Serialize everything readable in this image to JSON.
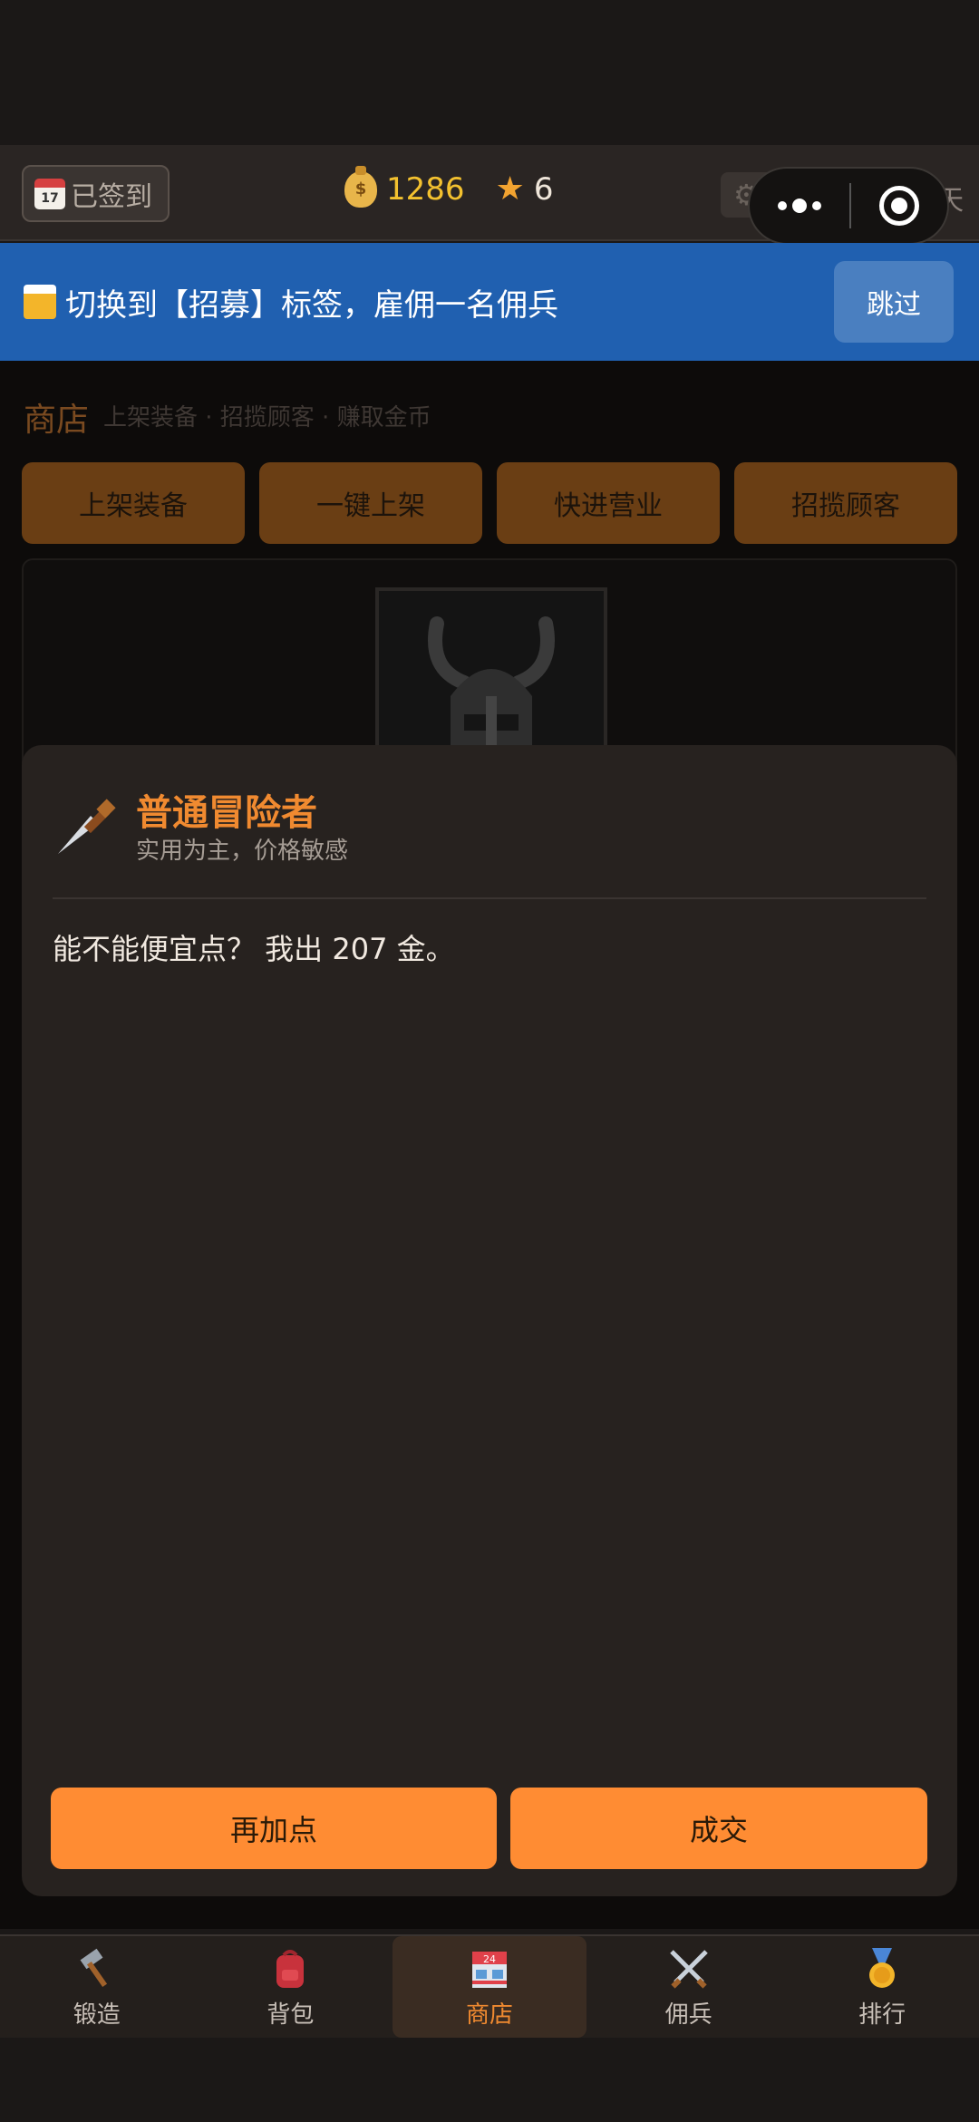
{
  "topbar": {
    "checkin_label": "已签到",
    "calendar_day": "17",
    "gold": "1286",
    "stars": "6",
    "settings_label": "设置",
    "day_label": "第 1 天"
  },
  "guide": {
    "text": "切换到【招募】标签，雇佣一名佣兵",
    "skip_label": "跳过"
  },
  "shop": {
    "title": "商店",
    "subtitle": "上架装备 · 招揽顾客 · 赚取金币",
    "actions": [
      "上架装备",
      "一键上架",
      "快进营业",
      "招揽顾客"
    ]
  },
  "dialog": {
    "name": "普通冒险者",
    "desc": "实用为主，价格敏感",
    "message": "能不能便宜点？ 我出 207 金。",
    "bargain_label": "再加点",
    "deal_label": "成交"
  },
  "nav": {
    "items": [
      {
        "label": "锻造",
        "icon": "hammer-icon"
      },
      {
        "label": "背包",
        "icon": "backpack-icon"
      },
      {
        "label": "商店",
        "icon": "store-icon"
      },
      {
        "label": "佣兵",
        "icon": "crossed-swords-icon"
      },
      {
        "label": "排行",
        "icon": "medal-icon"
      }
    ],
    "active": "商店"
  },
  "colors": {
    "accent": "#ff8c33",
    "guide_bg": "#2060b0",
    "gold": "#f3c12f"
  }
}
